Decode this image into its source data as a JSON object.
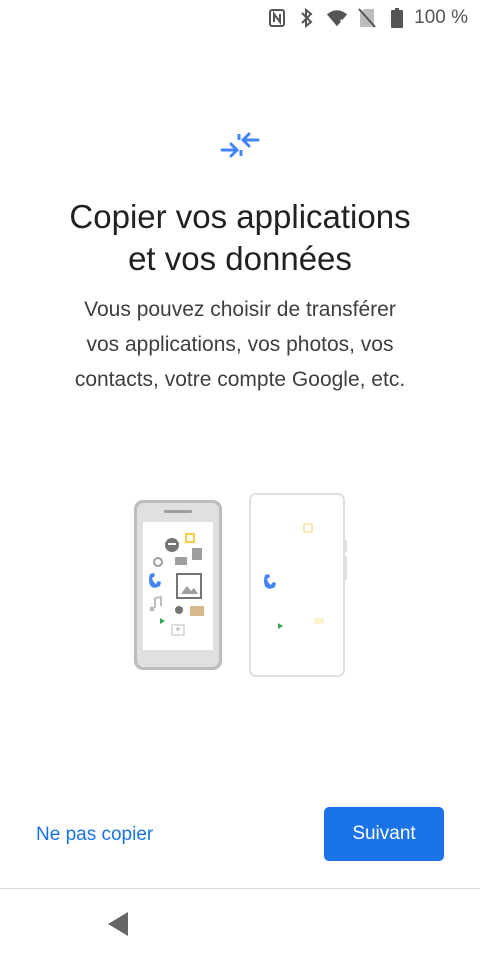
{
  "status_bar": {
    "icons": [
      "nfc-icon",
      "bluetooth-icon",
      "wifi-icon",
      "no-sim-icon",
      "battery-icon"
    ],
    "battery_text": "100 %"
  },
  "header": {
    "icon": "transfer-arrows-icon",
    "accent_color": "#4285f4"
  },
  "title": {
    "line1": "Copier vos applications",
    "line2": "et vos données"
  },
  "subtitle": {
    "line1": "Vous pouvez choisir de transférer",
    "line2": "vos applications, vos photos, vos",
    "line3": "contacts, votre compte Google, etc."
  },
  "illustration": {
    "name": "two-phones-transfer-illustration"
  },
  "actions": {
    "skip_label": "Ne pas copier",
    "next_label": "Suivant",
    "primary_color": "#1a73e8"
  },
  "nav": {
    "back_icon": "back-triangle-icon"
  }
}
